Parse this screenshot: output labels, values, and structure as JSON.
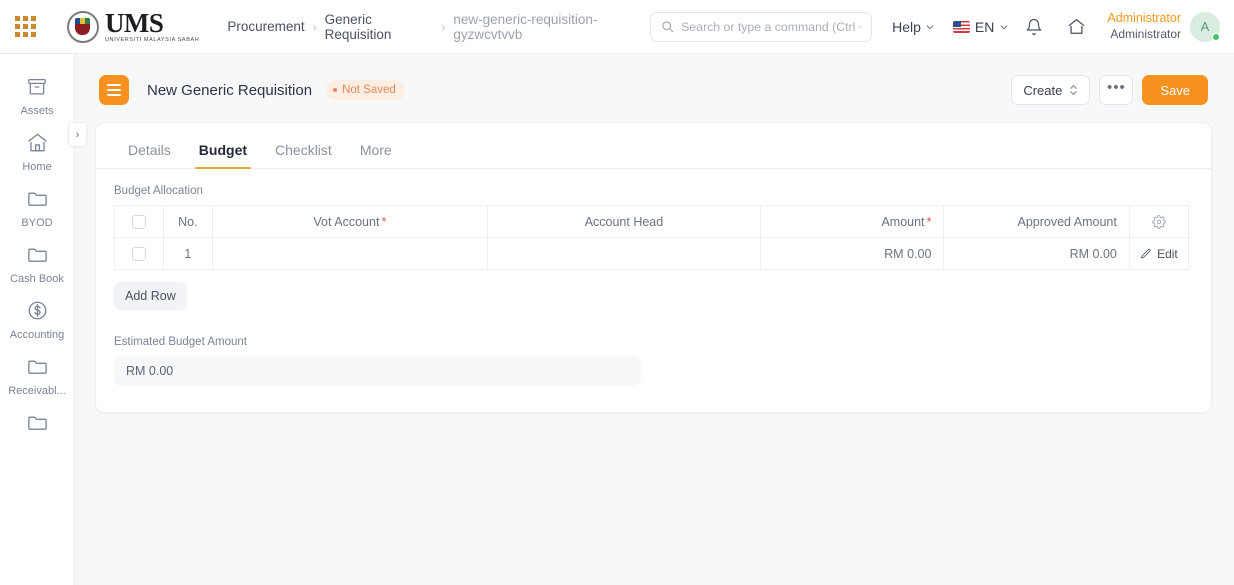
{
  "topbar": {
    "apps_icon": "apps-grid-icon",
    "logo": {
      "name": "UMS",
      "subtitle": "UNIVERSITI MALAYSIA SABAH"
    },
    "breadcrumb": [
      {
        "label": "Procurement",
        "current": false
      },
      {
        "label": "Generic Requisition",
        "current": false
      },
      {
        "label": "new-generic-requisition-gyzwcvtvvb",
        "current": true
      }
    ],
    "breadcrumb_separator": "›",
    "search": {
      "placeholder": "Search or type a command (Ctrl + G)",
      "value": ""
    },
    "help_label": "Help",
    "language_label": "EN",
    "flag": "us-flag-icon",
    "notifications_icon": "bell-icon",
    "home_icon": "home-icon",
    "user": {
      "name": "Administrator",
      "role": "Administrator",
      "initial": "A",
      "status": "online"
    }
  },
  "sidebar": {
    "items": [
      {
        "label": "Assets",
        "icon": "box-icon"
      },
      {
        "label": "Home",
        "icon": "home-icon"
      },
      {
        "label": "BYOD",
        "icon": "folder-icon"
      },
      {
        "label": "Cash Book",
        "icon": "folder-icon"
      },
      {
        "label": "Accounting",
        "icon": "dollar-circle-icon"
      },
      {
        "label": "Receivabl...",
        "icon": "folder-icon"
      },
      {
        "label": "",
        "icon": "folder-icon"
      }
    ]
  },
  "document": {
    "menu_icon": "hamburger-icon",
    "title": "New Generic Requisition",
    "status_badge": "Not Saved",
    "actions": {
      "create_label": "Create",
      "more_label": "•••",
      "save_label": "Save"
    },
    "collapse_toggle": "›"
  },
  "tabs": [
    {
      "label": "Details",
      "active": false
    },
    {
      "label": "Budget",
      "active": true
    },
    {
      "label": "Checklist",
      "active": false
    },
    {
      "label": "More",
      "active": false
    }
  ],
  "budget": {
    "section_label": "Budget Allocation",
    "columns": {
      "no": "No.",
      "vot_account": "Vot Account",
      "vot_account_required": "*",
      "account_head": "Account Head",
      "amount": "Amount",
      "amount_required": "*",
      "approved_amount": "Approved Amount",
      "settings_icon": "gear-icon"
    },
    "rows": [
      {
        "no": "1",
        "vot_account": "",
        "account_head": "",
        "amount": "RM 0.00",
        "approved_amount": "RM 0.00",
        "edit_label": "Edit"
      }
    ],
    "add_row_label": "Add Row",
    "estimated_label": "Estimated Budget Amount",
    "estimated_value": "RM 0.00"
  },
  "colors": {
    "accent": "#f7921e",
    "tab_underline": "#f0a33c",
    "badge_text": "#e8865a",
    "badge_bg": "#fdeee4",
    "required": "#e05252",
    "page_bg": "#f7f8fa",
    "status_dot": "#3fc469"
  }
}
